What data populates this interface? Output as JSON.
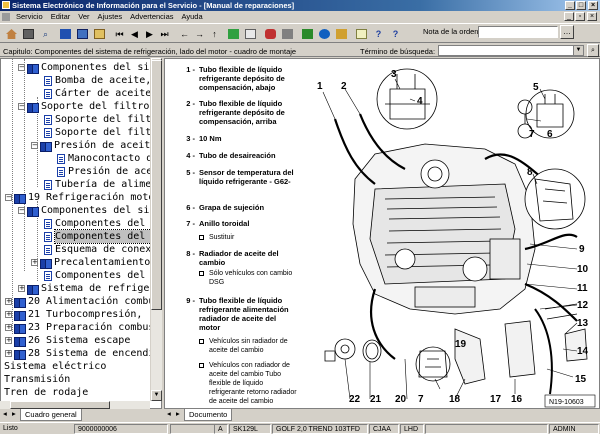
{
  "window": {
    "title": "Sistema Electrónico de Información para el Servicio - [Manual de reparaciones]"
  },
  "menu": {
    "items": [
      "Servicio",
      "Editar",
      "Ver",
      "Ajustes",
      "Advertencias",
      "Ayuda"
    ]
  },
  "toolbar": {
    "order_label": "Nota de la orden:"
  },
  "caption": {
    "label": "Capitulo: Componentes del sistema de refrigeración, lado del motor - cuadro de montaje",
    "search_label": "Término de búsqueda:",
    "search_value": ""
  },
  "tree": {
    "nodes": [
      {
        "text": "Componentes del sis",
        "icon": "book-icon"
      },
      {
        "text": "Bomba de aceite,",
        "icon": "document-icon"
      },
      {
        "text": "Cárter de aceite,",
        "icon": "document-icon"
      },
      {
        "text": "Soporte del filtro",
        "icon": "book-icon"
      },
      {
        "text": "Soporte del filtr",
        "icon": "document-icon"
      },
      {
        "text": "Soporte del filtr",
        "icon": "document-icon"
      },
      {
        "text": "Presión de aceite",
        "icon": "book-icon"
      },
      {
        "text": "Manocontacto de",
        "icon": "document-icon"
      },
      {
        "text": "Presión de acei",
        "icon": "document-icon"
      },
      {
        "text": "Tubería de alimen",
        "icon": "document-icon"
      },
      {
        "text": "19 Refrigeración moto",
        "icon": "book-icon"
      },
      {
        "text": "Componentes del sis",
        "icon": "book-icon"
      },
      {
        "text": "Componentes del s",
        "icon": "document-icon"
      },
      {
        "text": "Componentes del s",
        "icon": "document-icon"
      },
      {
        "text": "Esquema de conexi",
        "icon": "document-icon"
      },
      {
        "text": "Precalentamiento",
        "icon": "book-icon"
      },
      {
        "text": "Componentes del s",
        "icon": "document-icon"
      },
      {
        "text": "Sistema de refrige",
        "icon": "book-icon"
      },
      {
        "text": "20 Alimentación combu",
        "icon": "book-icon"
      },
      {
        "text": "21 Turbocompresión,",
        "icon": "book-icon"
      },
      {
        "text": "23 Preparación combus",
        "icon": "book-icon"
      },
      {
        "text": "26 Sistema escape",
        "icon": "book-icon"
      },
      {
        "text": "28 Sistema de encendi",
        "icon": "book-icon"
      },
      {
        "text": "Sistema eléctrico",
        "icon": ""
      },
      {
        "text": "Transmisión",
        "icon": ""
      },
      {
        "text": "Tren de rodaje",
        "icon": ""
      }
    ],
    "tab_label": "Cuadro general"
  },
  "document": {
    "tab_label": "Documento",
    "items": [
      {
        "num": "1 -",
        "text": "Tubo flexible de líquido refrigerante depósito de compensación, abajo"
      },
      {
        "num": "2 -",
        "text": "Tubo flexible de líquido refrigerante depósito de compensación, arriba"
      },
      {
        "num": "3 -",
        "text": "10 Nm"
      },
      {
        "num": "4 -",
        "text": "Tubo de desaireación"
      },
      {
        "num": "5 -",
        "text": "Sensor de temperatura del líquido refrigerante - G62-"
      },
      {
        "num": "6 -",
        "text": "Grapa de sujeción"
      },
      {
        "num": "7 -",
        "text": "Anillo toroidal"
      },
      {
        "num": "8 -",
        "text": "Radiador de aceite del cambio"
      },
      {
        "num": "9 -",
        "text": "Tubo flexible de líquido refrigerante alimentación radiador de aceite del motor"
      }
    ],
    "subitems": {
      "sustituir": "Sustituir",
      "solo_dsg": "Sólo vehículos con cambio DSG",
      "sin_radiador": "Vehículos sin radiador de aceite del cambio",
      "con_radiador": "Vehículos con radiador de aceite del cambio Tubo flexible de líquido refrigerante retorno radiador de aceite del cambio"
    },
    "figure_id": "N19-10603",
    "callouts": [
      "1",
      "2",
      "3",
      "4",
      "5",
      "7",
      "6",
      "8",
      "9",
      "10",
      "11",
      "12",
      "13",
      "14",
      "15",
      "16",
      "17",
      "18",
      "19",
      "20",
      "7",
      "21",
      "22"
    ]
  },
  "status": {
    "state": "Listo",
    "code": "9000000006",
    "fields": [
      "A",
      "SK129L",
      "GOLF 2,0 TREND 103TFD",
      "CJAA",
      "LHD",
      "ADMIN"
    ]
  }
}
